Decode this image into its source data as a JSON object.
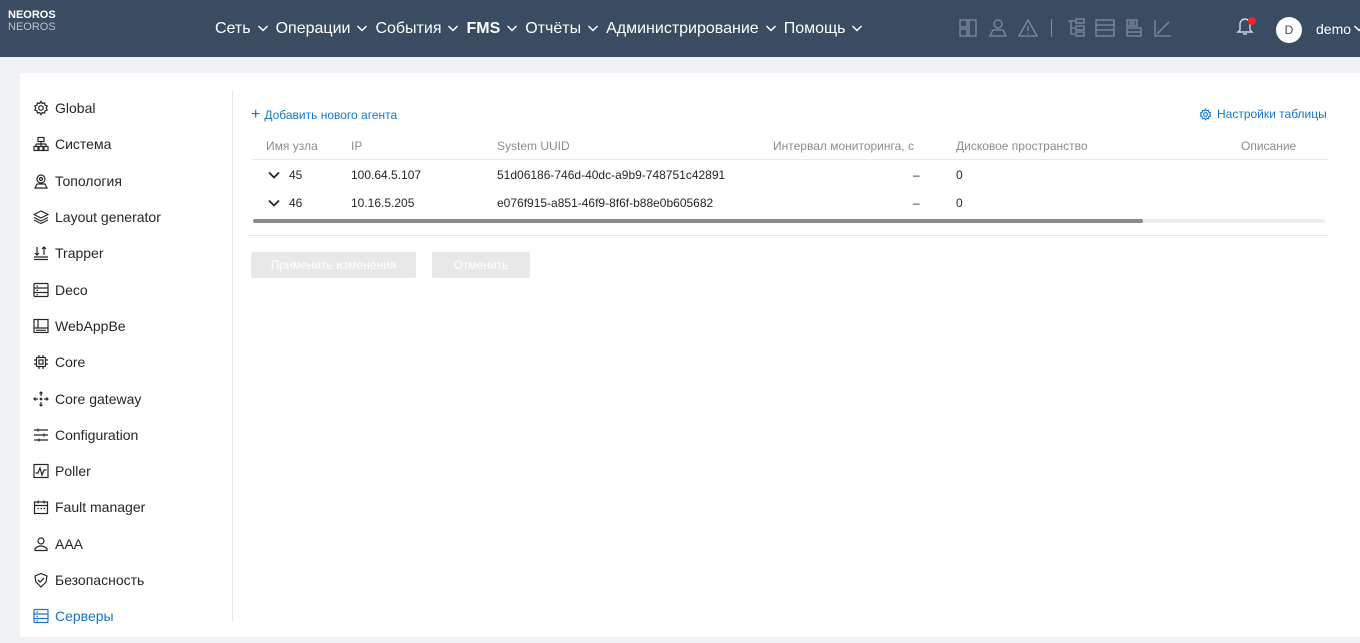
{
  "brand": {
    "name": "NEOROS",
    "sub": "NEOROS"
  },
  "nav": [
    {
      "label": "Сеть",
      "dropdown": true
    },
    {
      "label": "Операции",
      "dropdown": true
    },
    {
      "label": "События",
      "dropdown": true
    },
    {
      "label": "FMS",
      "dropdown": true,
      "bold": true
    },
    {
      "label": "Отчёты",
      "dropdown": true
    },
    {
      "label": "Администрирование",
      "dropdown": true
    },
    {
      "label": "Помощь",
      "dropdown": true
    }
  ],
  "toolbar_icons": [
    "dashboard-icon",
    "map-user-icon",
    "alert-triangle-icon",
    "tree-icon",
    "list-icon",
    "inbox-icon",
    "chart-icon"
  ],
  "user": {
    "avatar_letter": "D",
    "name": "demo"
  },
  "sidebar": {
    "items": [
      {
        "label": "Global",
        "icon": "settings-icon"
      },
      {
        "label": "Система",
        "icon": "network-icon"
      },
      {
        "label": "Топология",
        "icon": "location-icon"
      },
      {
        "label": "Layout generator",
        "icon": "layers-icon"
      },
      {
        "label": "Trapper",
        "icon": "sort-icon"
      },
      {
        "label": "Deco",
        "icon": "server-icon"
      },
      {
        "label": "WebAppBe",
        "icon": "panel-icon"
      },
      {
        "label": "Core",
        "icon": "chip-icon"
      },
      {
        "label": "Core gateway",
        "icon": "move-icon"
      },
      {
        "label": "Configuration",
        "icon": "sliders-icon"
      },
      {
        "label": "Poller",
        "icon": "pulse-icon"
      },
      {
        "label": "Fault manager",
        "icon": "calendar-icon"
      },
      {
        "label": "AAA",
        "icon": "users-icon"
      },
      {
        "label": "Безопасность",
        "icon": "shield-icon"
      },
      {
        "label": "Серверы",
        "icon": "servers-icon",
        "active": true
      }
    ]
  },
  "actions": {
    "add_agent": "Добавить нового агента",
    "table_settings": "Настройки таблицы"
  },
  "table": {
    "columns": [
      "Имя узла",
      "IP",
      "System UUID",
      "Интервал мониторинга, с",
      "Дисковое пространство",
      "Описание"
    ],
    "rows": [
      {
        "name": "45",
        "ip": "100.64.5.107",
        "uuid": "51d06186-746d-40dc-a9b9-748751c42891",
        "interval": "–",
        "disk": "0",
        "desc": ""
      },
      {
        "name": "46",
        "ip": "10.16.5.205",
        "uuid": "e076f915-a851-46f9-8f6f-b88e0b605682",
        "interval": "–",
        "disk": "0",
        "desc": ""
      }
    ],
    "scroll_fraction": 0.83
  },
  "buttons": {
    "apply": "Применить изменения",
    "cancel": "Отменить"
  },
  "colors": {
    "topbar": "#3a4c61",
    "accent": "#1677c9",
    "badge": "#f5222d"
  }
}
